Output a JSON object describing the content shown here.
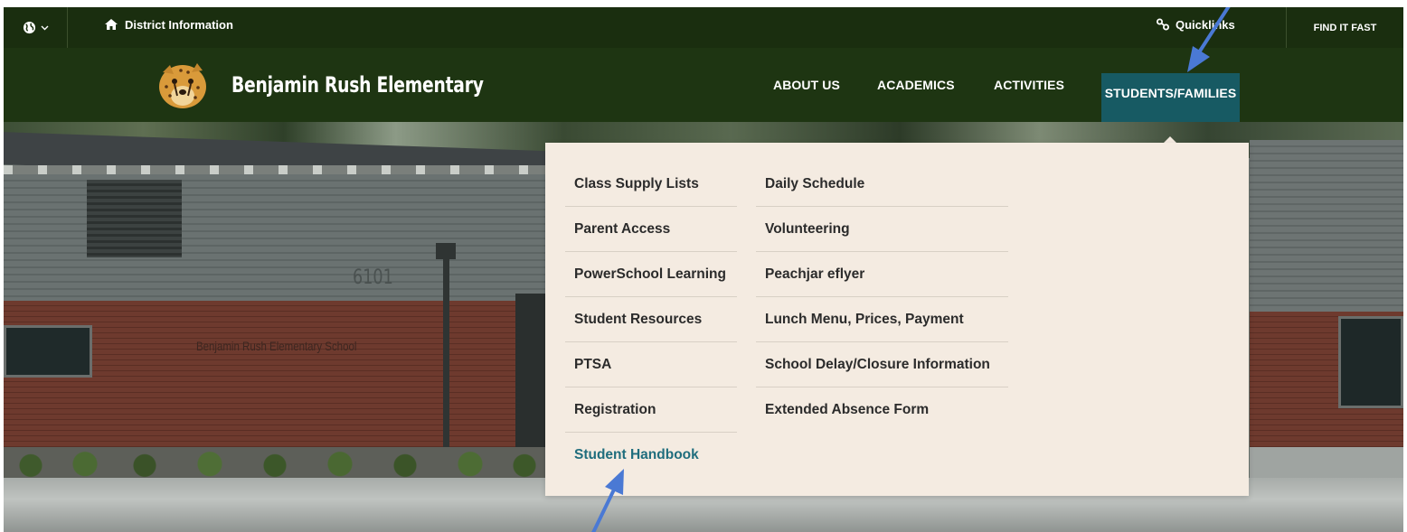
{
  "utility_bar": {
    "district_label": "District Information",
    "quicklinks_label": "Quicklinks",
    "find_it_fast_label": "FIND IT FAST"
  },
  "header": {
    "school_name": "Benjamin Rush Elementary",
    "nav": [
      "ABOUT US",
      "ACADEMICS",
      "ACTIVITIES",
      "STUDENTS/FAMILIES"
    ],
    "active_nav": "STUDENTS/FAMILIES"
  },
  "hero": {
    "building_number": "6101",
    "building_sign": "Benjamin Rush Elementary School"
  },
  "mega_menu": {
    "column_1": [
      "Class Supply Lists",
      "Parent Access",
      "PowerSchool Learning",
      "Student Resources",
      "PTSA",
      "Registration",
      "Student Handbook"
    ],
    "column_2": [
      "Daily Schedule",
      "Volunteering",
      "Peachjar eflyer",
      "Lunch Menu, Prices, Payment",
      "School Delay/Closure Information",
      "Extended Absence Form"
    ],
    "highlighted_item": "Student Handbook"
  },
  "colors": {
    "top_bar": "#1a2e0f",
    "header": "#1e3512",
    "active_tab": "#175a63",
    "menu_bg": "#f4ebe1",
    "highlight_link": "#1f6d7d",
    "annotation_arrow": "#4a79d4"
  },
  "icons": {
    "language": "globe-icon",
    "district": "home-icon",
    "quicklinks": "link-icon"
  }
}
